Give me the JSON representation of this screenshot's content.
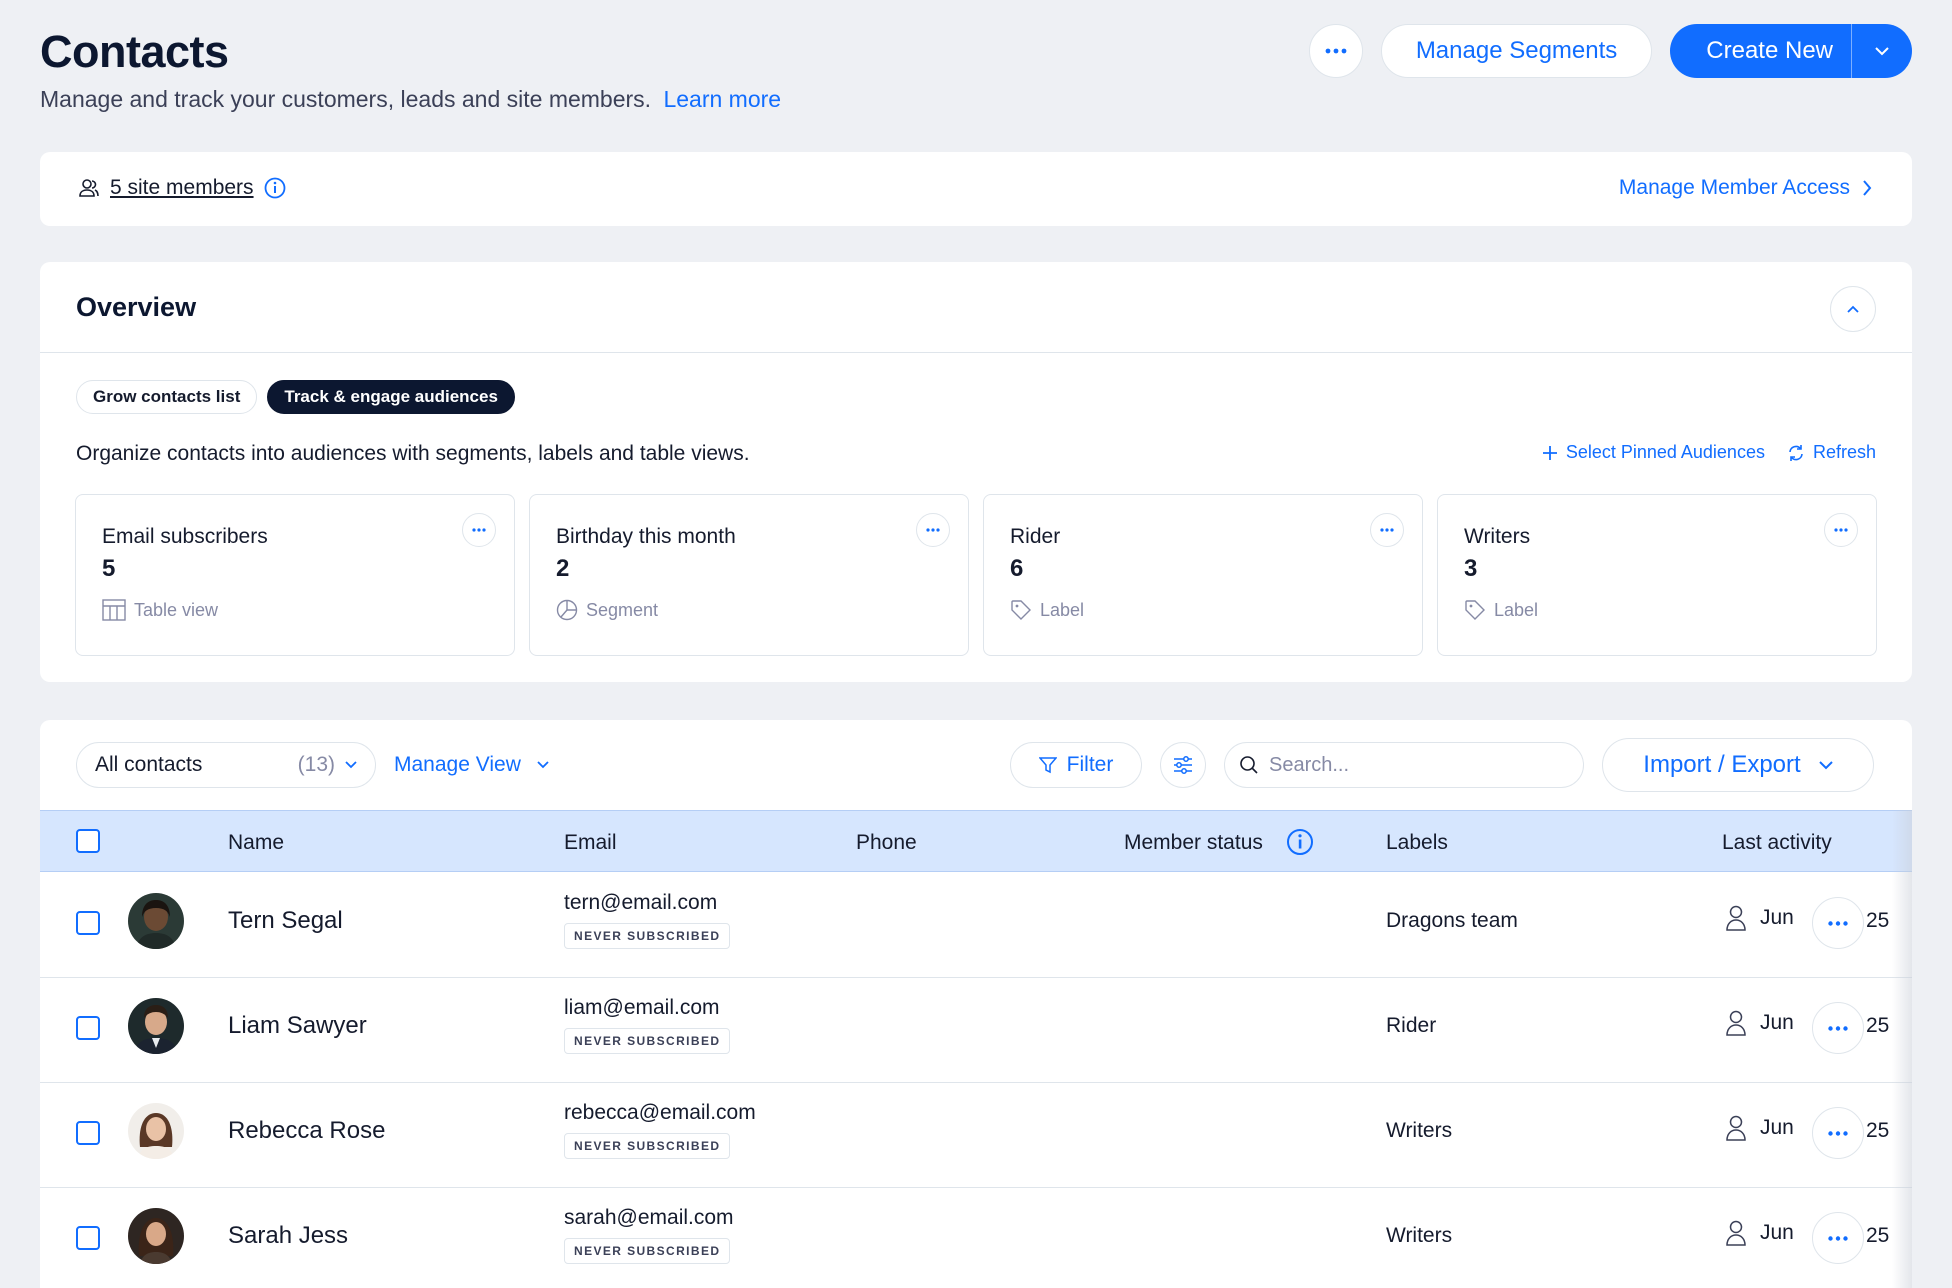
{
  "header": {
    "title": "Contacts",
    "subtitle": "Manage and track your customers, leads and site members.",
    "learn_more": "Learn more",
    "manage_segments": "Manage Segments",
    "create_new": "Create New"
  },
  "members_bar": {
    "site_members": "5 site members",
    "manage_access": "Manage Member Access"
  },
  "overview": {
    "title": "Overview",
    "tabs": [
      {
        "label": "Grow contacts list",
        "active": false
      },
      {
        "label": "Track & engage audiences",
        "active": true
      }
    ],
    "description": "Organize contacts into audiences with segments, labels and table views.",
    "select_pinned": "Select Pinned Audiences",
    "refresh": "Refresh",
    "cards": [
      {
        "title": "Email subscribers",
        "count": "5",
        "type": "Table view",
        "icon": "table-icon"
      },
      {
        "title": "Birthday this month",
        "count": "2",
        "type": "Segment",
        "icon": "pie-icon"
      },
      {
        "title": "Rider",
        "count": "6",
        "type": "Label",
        "icon": "tag-icon"
      },
      {
        "title": "Writers",
        "count": "3",
        "type": "Label",
        "icon": "tag-icon"
      }
    ]
  },
  "toolbar": {
    "view_select": "All contacts",
    "view_count": "(13)",
    "manage_view": "Manage View",
    "filter": "Filter",
    "search_placeholder": "Search...",
    "import_export": "Import / Export"
  },
  "table": {
    "columns": [
      "Name",
      "Email",
      "Phone",
      "Member status",
      "Labels",
      "Last activity"
    ],
    "rows": [
      {
        "name": "Tern Segal",
        "email": "tern@email.com",
        "badge": "NEVER SUBSCRIBED",
        "label": "Dragons team",
        "last_activity": "Jun",
        "year": "25"
      },
      {
        "name": "Liam Sawyer",
        "email": "liam@email.com",
        "badge": "NEVER SUBSCRIBED",
        "label": "Rider",
        "last_activity": "Jun",
        "year": "25"
      },
      {
        "name": "Rebecca Rose",
        "email": "rebecca@email.com",
        "badge": "NEVER SUBSCRIBED",
        "label": "Writers",
        "last_activity": "Jun",
        "year": "25"
      },
      {
        "name": "Sarah Jess",
        "email": "sarah@email.com",
        "badge": "NEVER SUBSCRIBED",
        "label": "Writers",
        "last_activity": "Jun",
        "year": "25"
      }
    ]
  },
  "colors": {
    "accent": "#116DFF",
    "background": "#EEF0F4",
    "header_row": "#D6E6FE",
    "dark": "#0C1730"
  }
}
